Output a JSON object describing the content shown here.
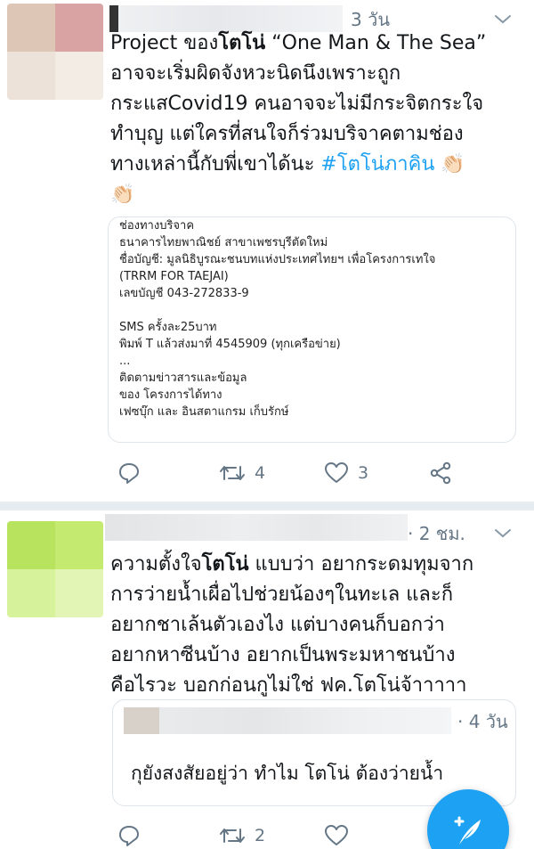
{
  "tweets": [
    {
      "time": "3 วัน",
      "text_parts": [
        {
          "t": "Project ของ"
        },
        {
          "t": "โตโน่",
          "bold": true
        },
        {
          "t": " “One Man & The Sea”\nอาจจะเริ่มผิดจังหวะนิดนึงเพราะถูก\nกระแสCovid19 คนอาจจะไม่มีกระจิตกระใจ\nทำบุญ แต่ใครที่สนใจก็ร่วมบริจาคตามช่อง\nทางเหล่านี้กับพี่เขาได้นะ "
        },
        {
          "t": "#โตโน่ภาคิน",
          "hashtag": true
        },
        {
          "t": " 👏🏻\n👏🏻"
        }
      ],
      "card_text": "ช่องทางบริจาค\nธนาคารไทยพาณิชย์ สาขาเพชรบุรีตัดใหม่\nชื่อบัญชี: มูลนิธิบูรณะชนบทแห่งประเทศไทยฯ เพื่อโครงการเทใจ\n(TRRM FOR TAEJAI)\nเลขบัญชี 043-272833-9\n\nSMS ครั้งละ25บาท\nพิมพ์ T แล้วส่งมาที่ 4545909 (ทุกเครือข่าย)\n...\nติดตามข่าวสารและข้อมูล\nของ โครงการได้ทาง\nเฟซบุ๊ก และ อินสตาแกรม เก็บรักษ์",
      "actions": {
        "reply": "",
        "retweet": "4",
        "like": "3"
      },
      "avatar_colors": [
        "#ddc6b6",
        "#d9a3a3",
        "#ece2da",
        "#f2ece4"
      ]
    },
    {
      "time": "· 2 ชม.",
      "text_parts": [
        {
          "t": "ความตั้งใจ"
        },
        {
          "t": "โตโน่",
          "bold": true
        },
        {
          "t": " แบบว่า อยากระดมทุมจาก\nการว่ายน้ำเผื่อไปช่วยน้องๆในทะเล และก็\nอยากชาเล้นตัวเองไง แต่บางคนก็บอกว่า\nอยากหาซีนบ้าง อยากเป็นพระมหาชนบ้าง\nคือไรวะ บอกก่อนกูไม่ใช่ ฟค.โตโน่จ้าาาาา"
        }
      ],
      "quote": {
        "time": "· 4 วัน",
        "text": "กุยังสงสัยอยู่ว่า ทำไม โตโน่ ต้องว่ายน้ำ"
      },
      "actions": {
        "reply": "",
        "retweet": "2",
        "like": ""
      },
      "avatar_colors": [
        "#b7e35e",
        "#c4ea6f",
        "#d6f29a",
        "#e2f5b5"
      ]
    }
  ]
}
